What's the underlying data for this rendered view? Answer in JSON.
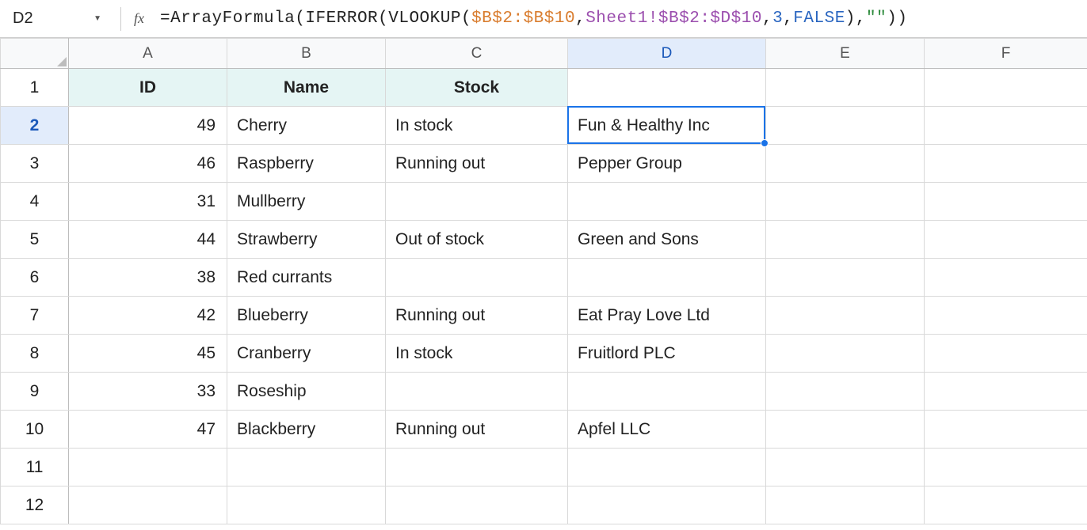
{
  "name_box": {
    "value": "D2"
  },
  "fx_label": "fx",
  "formula": {
    "raw": "=ArrayFormula(IFERROR(VLOOKUP($B$2:$B$10,Sheet1!$B$2:$D$10,3,FALSE),\"\"))",
    "tokens": [
      {
        "text": "=ArrayFormula(IFERROR(VLOOKUP(",
        "cls": "tok-black"
      },
      {
        "text": "$B$2:$B$10",
        "cls": "tok-orange"
      },
      {
        "text": ",",
        "cls": "tok-black"
      },
      {
        "text": "Sheet1!$B$2:$D$10",
        "cls": "tok-purple"
      },
      {
        "text": ",",
        "cls": "tok-black"
      },
      {
        "text": "3",
        "cls": "tok-blue"
      },
      {
        "text": ",",
        "cls": "tok-black"
      },
      {
        "text": "FALSE",
        "cls": "tok-blue"
      },
      {
        "text": "),",
        "cls": "tok-black"
      },
      {
        "text": "\"\"",
        "cls": "tok-green"
      },
      {
        "text": "))",
        "cls": "tok-black"
      }
    ]
  },
  "columns": [
    "A",
    "B",
    "C",
    "D",
    "E",
    "F"
  ],
  "active_col": "D",
  "active_row": 2,
  "row_count": 12,
  "headers": {
    "A": "ID",
    "B": "Name",
    "C": "Stock"
  },
  "rows": [
    {
      "n": 2,
      "A": "49",
      "B": "Cherry",
      "C": "In stock",
      "D": "Fun & Healthy Inc"
    },
    {
      "n": 3,
      "A": "46",
      "B": "Raspberry",
      "C": "Running out",
      "D": "Pepper Group"
    },
    {
      "n": 4,
      "A": "31",
      "B": "Mullberry",
      "C": "",
      "D": ""
    },
    {
      "n": 5,
      "A": "44",
      "B": "Strawberry",
      "C": "Out of stock",
      "D": "Green and Sons"
    },
    {
      "n": 6,
      "A": "38",
      "B": "Red currants",
      "C": "",
      "D": ""
    },
    {
      "n": 7,
      "A": "42",
      "B": "Blueberry",
      "C": "Running out",
      "D": "Eat Pray Love Ltd"
    },
    {
      "n": 8,
      "A": "45",
      "B": "Cranberry",
      "C": "In stock",
      "D": "Fruitlord PLC"
    },
    {
      "n": 9,
      "A": "33",
      "B": "Roseship",
      "C": "",
      "D": ""
    },
    {
      "n": 10,
      "A": "47",
      "B": "Blackberry",
      "C": "Running out",
      "D": "Apfel LLC"
    }
  ],
  "selection": {
    "cell": "D2"
  }
}
